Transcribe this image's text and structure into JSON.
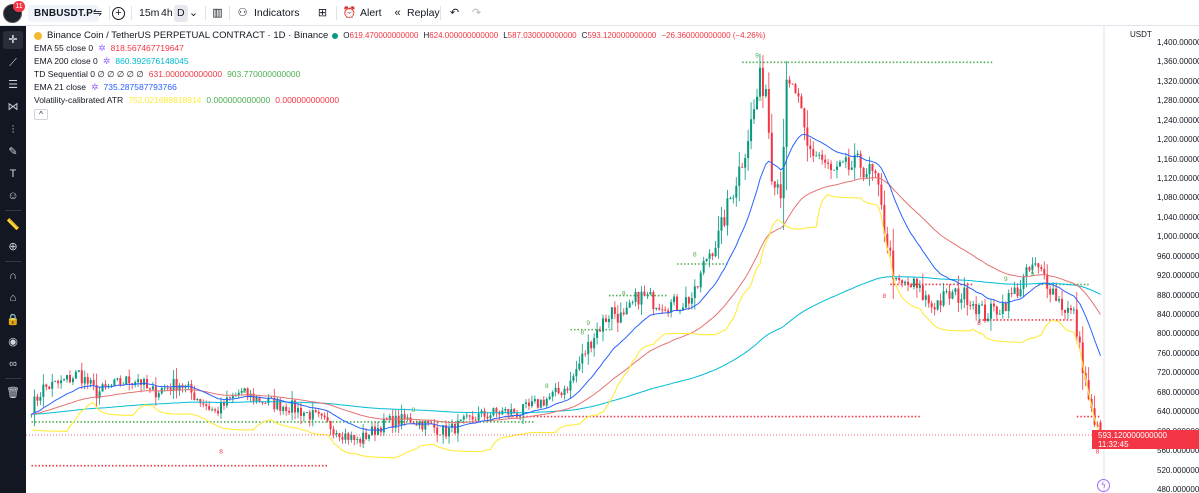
{
  "header": {
    "notification_count": "11",
    "symbol": "BNBUSDT.P",
    "intervals": [
      "15m",
      "4h",
      "D"
    ],
    "active_interval": "D",
    "indicators_label": "Indicators",
    "alert_label": "Alert",
    "replay_label": "Replay",
    "icons": [
      "avatar-icon",
      "compare-icon",
      "add-symbol-icon",
      "chevron-down-icon",
      "indicators-icon",
      "layout-grid-icon",
      "alert-clock-icon",
      "replay-icon",
      "undo-icon",
      "redo-icon"
    ]
  },
  "sidebar": {
    "tools": [
      "crosshair-icon",
      "trend-line-icon",
      "fib-retracement-icon",
      "pattern-icon",
      "forecast-icon",
      "brush-icon",
      "text-icon",
      "emoji-icon",
      "ruler-icon",
      "zoom-icon",
      "magnet-icon",
      "lock-drawing-icon",
      "lock-icon",
      "eye-icon",
      "link-icon",
      "trash-icon"
    ]
  },
  "legend": {
    "title": "Binance Coin / TetherUS PERPETUAL CONTRACT · 1D · Binance",
    "ohlc": {
      "open_label": "O",
      "open": "619.470000000000",
      "high_label": "H",
      "high": "624.000000000000",
      "low_label": "L",
      "low": "587.030000000000",
      "close_label": "C",
      "close": "593.120000000000",
      "change": "−26.360000000000 (−4.26%)"
    },
    "indicators": [
      {
        "name": "EMA 55 close 0",
        "values": [
          "818.567467719647"
        ],
        "colors": [
          "#f23645"
        ]
      },
      {
        "name": "EMA 200 close 0",
        "values": [
          "860.392676148045"
        ],
        "colors": [
          "#00bcd4"
        ]
      },
      {
        "name": "TD Sequential 0 ∅ ∅ ∅ ∅ ∅",
        "values": [
          "631.000000000000",
          "903.770000000000"
        ],
        "colors": [
          "#f23645",
          "#4caf50"
        ]
      },
      {
        "name": "EMA 21 close",
        "values": [
          "735.287587793766"
        ],
        "colors": [
          "#2962ff"
        ]
      },
      {
        "name": "Volatility-calibrated ATR",
        "values": [
          "752.021688818914",
          "0.000000000000",
          "0.000000000000"
        ],
        "colors": [
          "#ffeb3b",
          "#4caf50",
          "#f23645"
        ]
      }
    ],
    "collapse_glyph": "^"
  },
  "price_axis": {
    "unit": "USDT",
    "labels": [
      "1,400.000000000000",
      "1,360.000000000000",
      "1,320.000000000000",
      "1,280.000000000000",
      "1,240.000000000000",
      "1,200.000000000000",
      "1,160.000000000000",
      "1,120.000000000000",
      "1,080.000000000000",
      "1,040.000000000000",
      "1,000.000000000000",
      "960.000000000000",
      "920.000000000000",
      "880.000000000000",
      "840.000000000000",
      "800.000000000000",
      "760.000000000000",
      "720.000000000000",
      "680.000000000000",
      "640.000000000000",
      "600.000000000000",
      "560.000000000000",
      "520.000000000000",
      "480.000000000000"
    ],
    "current_price": "593.120000000000",
    "countdown": "11:32:45"
  },
  "colors": {
    "up": "#089981",
    "down": "#f23645",
    "ema21": "#2962ff",
    "ema55": "#e57373",
    "ema200": "#00bcd4",
    "atr": "#ffeb3b",
    "support_line": "#4caf50",
    "resistance_line": "#f23645"
  },
  "chart_data": {
    "type": "candlestick",
    "symbol": "BNBUSDT.P",
    "interval": "1D",
    "ylim": [
      480,
      1410
    ],
    "y_ticks": [
      480,
      520,
      560,
      600,
      640,
      680,
      720,
      760,
      800,
      840,
      880,
      920,
      960,
      1000,
      1040,
      1080,
      1120,
      1160,
      1200,
      1240,
      1280,
      1320,
      1360,
      1400
    ],
    "grid": false,
    "price_path_anchors": [
      [
        0,
        650
      ],
      [
        4,
        690
      ],
      [
        10,
        700
      ],
      [
        16,
        720
      ],
      [
        22,
        680
      ],
      [
        30,
        700
      ],
      [
        36,
        710
      ],
      [
        40,
        680
      ],
      [
        50,
        700
      ],
      [
        58,
        660
      ],
      [
        62,
        640
      ],
      [
        70,
        680
      ],
      [
        80,
        660
      ],
      [
        88,
        650
      ],
      [
        96,
        630
      ],
      [
        104,
        600
      ],
      [
        110,
        580
      ],
      [
        120,
        620
      ],
      [
        128,
        625
      ],
      [
        140,
        600
      ],
      [
        150,
        630
      ],
      [
        158,
        640
      ],
      [
        165,
        640
      ],
      [
        170,
        655
      ],
      [
        178,
        680
      ],
      [
        182,
        700
      ],
      [
        185,
        740
      ],
      [
        190,
        800
      ],
      [
        196,
        850
      ],
      [
        200,
        830
      ],
      [
        205,
        880
      ],
      [
        210,
        870
      ],
      [
        218,
        860
      ],
      [
        224,
        880
      ],
      [
        228,
        960
      ],
      [
        232,
        1000
      ],
      [
        236,
        1080
      ],
      [
        240,
        1160
      ],
      [
        244,
        1260
      ],
      [
        246,
        1320
      ],
      [
        248,
        1310
      ],
      [
        250,
        1140
      ],
      [
        253,
        1100
      ],
      [
        255,
        1300
      ],
      [
        258,
        1300
      ],
      [
        262,
        1180
      ],
      [
        266,
        1170
      ],
      [
        270,
        1130
      ],
      [
        275,
        1140
      ],
      [
        280,
        1150
      ],
      [
        285,
        1120
      ],
      [
        288,
        1020
      ],
      [
        292,
        900
      ],
      [
        298,
        900
      ],
      [
        304,
        860
      ],
      [
        310,
        880
      ],
      [
        316,
        880
      ],
      [
        322,
        840
      ],
      [
        328,
        860
      ],
      [
        334,
        900
      ],
      [
        338,
        940
      ],
      [
        342,
        920
      ],
      [
        348,
        860
      ],
      [
        352,
        840
      ],
      [
        356,
        700
      ],
      [
        359,
        610
      ],
      [
        361,
        593
      ]
    ],
    "td_sequential_labels": [
      {
        "label": "9",
        "day": 245,
        "price": 1370,
        "color": "#4caf50"
      },
      {
        "label": "8",
        "day": 246,
        "price": 1280,
        "color": "#4caf50"
      },
      {
        "label": "8",
        "day": 224,
        "price": 960,
        "color": "#4caf50"
      },
      {
        "label": "9",
        "day": 200,
        "price": 880,
        "color": "#4caf50"
      },
      {
        "label": "8",
        "day": 186,
        "price": 800,
        "color": "#4caf50"
      },
      {
        "label": "9",
        "day": 188,
        "price": 820,
        "color": "#4caf50"
      },
      {
        "label": "8",
        "day": 72,
        "price": 680,
        "color": "#4caf50"
      },
      {
        "label": "8",
        "day": 129,
        "price": 640,
        "color": "#4caf50"
      },
      {
        "label": "8",
        "day": 174,
        "price": 690,
        "color": "#4caf50"
      },
      {
        "label": "8",
        "day": 112,
        "price": 575,
        "color": "#f23645"
      },
      {
        "label": "8",
        "day": 64,
        "price": 555,
        "color": "#f23645"
      },
      {
        "label": "8",
        "day": 288,
        "price": 875,
        "color": "#f23645"
      },
      {
        "label": "8",
        "day": 320,
        "price": 820,
        "color": "#f23645"
      },
      {
        "label": "8",
        "day": 360,
        "price": 555,
        "color": "#f23645"
      },
      {
        "label": "9",
        "day": 329,
        "price": 910,
        "color": "#4caf50"
      },
      {
        "label": "9",
        "day": 338,
        "price": 920,
        "color": "#4caf50"
      }
    ],
    "support_lines": [
      {
        "from": 240,
        "to": 325,
        "price": 1360,
        "color": "#4caf50"
      },
      {
        "from": 218,
        "to": 235,
        "price": 945,
        "color": "#4caf50"
      },
      {
        "from": 340,
        "to": 357,
        "price": 903,
        "color": "#4caf50"
      },
      {
        "from": 0,
        "to": 170,
        "price": 620,
        "color": "#4caf50"
      },
      {
        "from": 195,
        "to": 215,
        "price": 880,
        "color": "#4caf50"
      },
      {
        "from": 182,
        "to": 196,
        "price": 810,
        "color": "#4caf50"
      }
    ],
    "resistance_lines": [
      {
        "from": 290,
        "to": 318,
        "price": 903,
        "color": "#f23645"
      },
      {
        "from": 320,
        "to": 352,
        "price": 830,
        "color": "#f23645"
      },
      {
        "from": 160,
        "to": 300,
        "price": 631,
        "color": "#f23645"
      },
      {
        "from": 0,
        "to": 100,
        "price": 530,
        "color": "#f23645"
      },
      {
        "from": 353,
        "to": 361,
        "price": 631,
        "color": "#f23645"
      }
    ],
    "current_price": 593.12
  }
}
